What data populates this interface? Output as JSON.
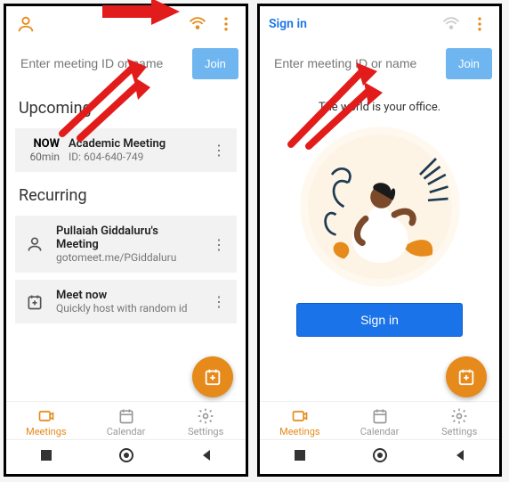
{
  "left": {
    "search_placeholder": "Enter meeting ID or name",
    "join_label": "Join",
    "upcoming_title": "Upcoming",
    "upcoming": {
      "now_label": "NOW",
      "duration": "60min",
      "title": "Academic Meeting",
      "meeting_id": "ID: 604-640-749"
    },
    "recurring_title": "Recurring",
    "recurring": [
      {
        "title": "Pullaiah Giddaluru's Meeting",
        "sub": "gotomeet.me/PGiddaluru"
      },
      {
        "title": "Meet now",
        "sub": "Quickly host with random id"
      }
    ]
  },
  "right": {
    "signin_link": "Sign in",
    "search_placeholder": "Enter meeting ID or name",
    "join_label": "Join",
    "tagline": "The world is your office.",
    "signin_button": "Sign in"
  },
  "tabs": {
    "meetings": "Meetings",
    "calendar": "Calendar",
    "settings": "Settings"
  },
  "colors": {
    "accent_orange": "#e58a1b",
    "accent_blue": "#1a73e8",
    "join_blue": "#6fb6f0",
    "annotation_red": "#e21b1b"
  }
}
